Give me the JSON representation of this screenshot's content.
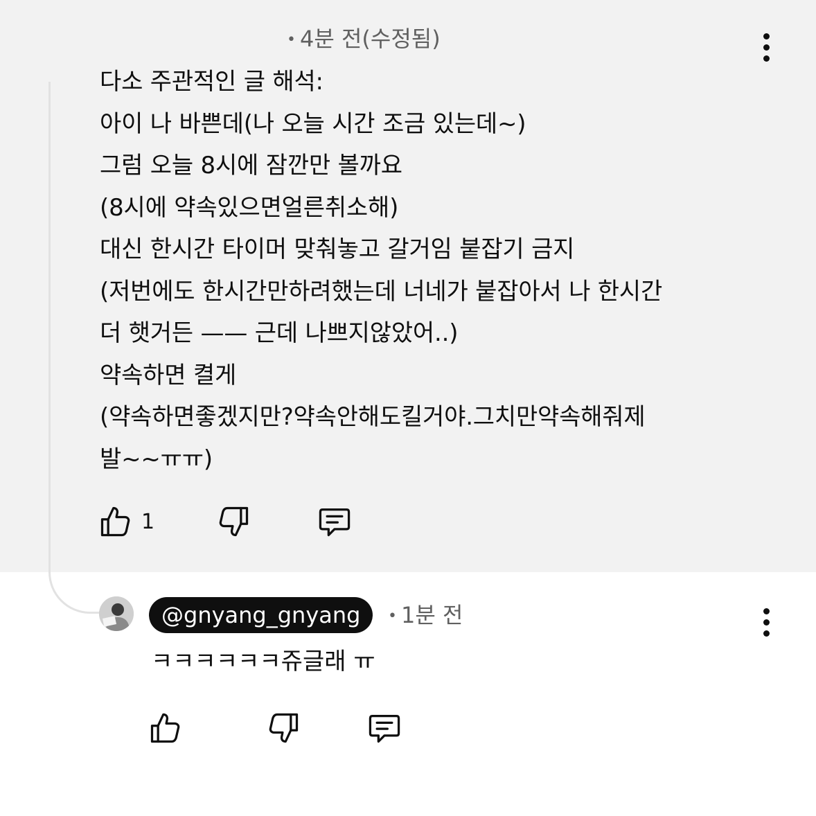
{
  "comment": {
    "meta": "4분 전(수정됨)",
    "lines": [
      "다소 주관적인 글 해석:",
      "아이 나 바쁜데(나 오늘 시간 조금 있는데~)",
      "그럼 오늘 8시에 잠깐만 볼까요",
      "(8시에 약속있으면얼른취소해)",
      "대신 한시간 타이머 맞춰놓고 갈거임 붙잡기 금지",
      "(저번에도 한시간만하려했는데 너네가 붙잡아서 나 한시간",
      "더 햇거든 —— 근데 나쁘지않았어..)",
      "약속하면 켤게",
      "(약속하면좋겠지만?약속안해도킬거야.그치만약속해줘제",
      "발~~ㅠㅠ)"
    ],
    "like_count": "1"
  },
  "reply": {
    "handle": "@gnyang_gnyang",
    "meta": "1분 전",
    "text": "ㅋㅋㅋㅋㅋㅋ쥬글래 ㅠ"
  },
  "icons": {
    "like": "thumbs-up-icon",
    "dislike": "thumbs-down-icon",
    "reply": "reply-comment-icon",
    "more": "more-vertical-icon"
  },
  "colors": {
    "highlight_bg": "#f2f2f2",
    "meta_text": "#606060",
    "handle_bg": "#0f0f0f"
  }
}
